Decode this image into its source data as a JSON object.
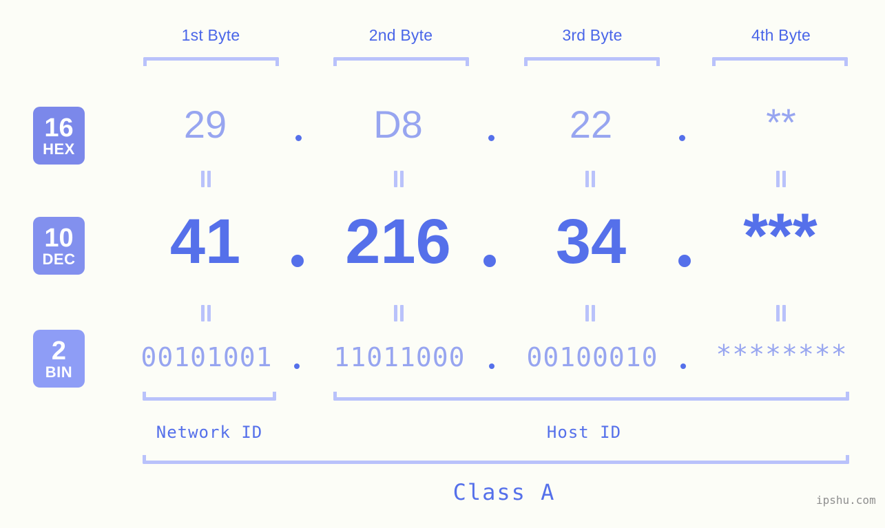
{
  "page": {
    "background_color": "#fcfdf7",
    "accent_color": "#5570ea",
    "light_accent_color": "#b9c2fb",
    "value_color": "#97a5f0",
    "watermark": "ipshu.com"
  },
  "byte_headers": [
    {
      "label": "1st Byte"
    },
    {
      "label": "2nd Byte"
    },
    {
      "label": "3rd Byte"
    },
    {
      "label": "4th Byte"
    }
  ],
  "bases": [
    {
      "number": "16",
      "name": "HEX",
      "color": "#7b88ea"
    },
    {
      "number": "10",
      "name": "DEC",
      "color": "#8290ee"
    },
    {
      "number": "2",
      "name": "BIN",
      "color": "#8e9df6"
    }
  ],
  "rows": {
    "hex": {
      "values": [
        "29",
        "D8",
        "22",
        "**"
      ],
      "separator": "."
    },
    "dec": {
      "values": [
        "41",
        "216",
        "34",
        "***"
      ],
      "separator": "."
    },
    "bin": {
      "values": [
        "00101001",
        "11011000",
        "00100010",
        "********"
      ],
      "separator": "."
    }
  },
  "equals_symbol": "=",
  "zones": [
    {
      "label": "Network ID"
    },
    {
      "label": "Host ID"
    }
  ],
  "class": {
    "label": "Class A"
  },
  "chart_data": {
    "type": "table",
    "title": "IP address byte breakdown",
    "columns": [
      "1st Byte",
      "2nd Byte",
      "3rd Byte",
      "4th Byte"
    ],
    "rows": [
      {
        "base": "16 HEX",
        "cells": [
          "29",
          "D8",
          "22",
          "**"
        ]
      },
      {
        "base": "10 DEC",
        "cells": [
          "41",
          "216",
          "34",
          "***"
        ]
      },
      {
        "base": "2 BIN",
        "cells": [
          "00101001",
          "11011000",
          "00100010",
          "********"
        ]
      }
    ],
    "network_id_bytes": 1,
    "host_id_bytes": 3,
    "address_class": "Class A"
  }
}
